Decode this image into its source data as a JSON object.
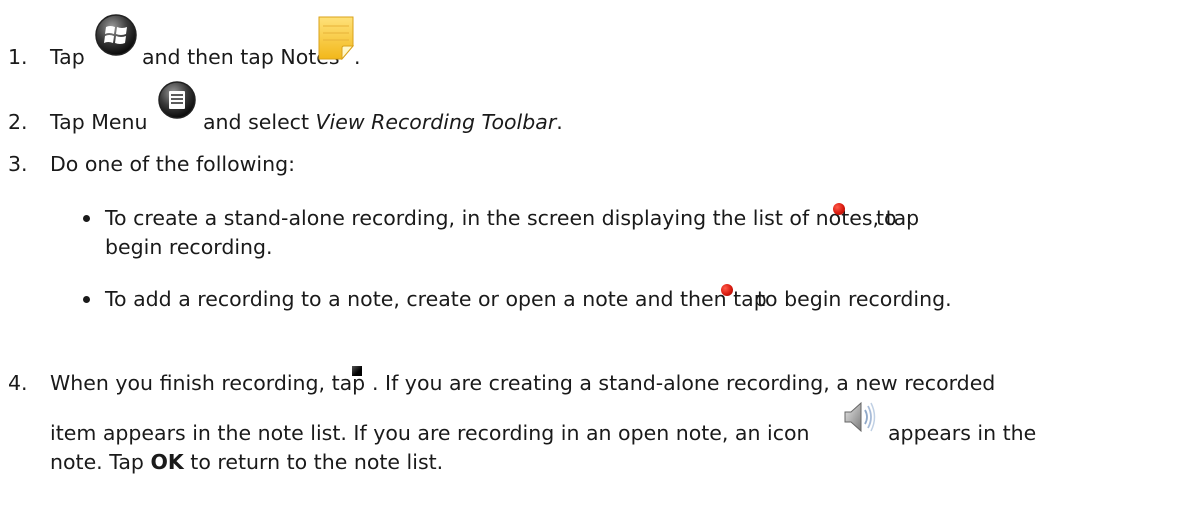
{
  "steps": [
    {
      "number": "1.",
      "parts": [
        "Tap",
        "and then tap Notes",
        "."
      ]
    },
    {
      "number": "2.",
      "parts": [
        "Tap Menu",
        "and select",
        "View Recording Toolbar",
        "."
      ]
    },
    {
      "number": "3.",
      "text": "Do one of the following:",
      "bullets": [
        {
          "line1_before": "To create a stand-alone recording, in the screen displaying the list of notes, tap",
          "line1_after": "to",
          "line2": "begin recording."
        },
        {
          "before": "To add a recording to a note, create or open a note and then tap",
          "after": "to begin recording."
        }
      ]
    },
    {
      "number": "4.",
      "line1_before": "When you finish recording, tap",
      "line1_after": ". If you are creating a stand-alone recording, a new recorded",
      "line2_before": "item appears in the note list. If you are recording in an open note, an icon",
      "line2_after": "appears in the",
      "line3_before": "note. Tap",
      "line3_bold": "OK",
      "line3_after": "to return to the note list."
    }
  ],
  "icons": {
    "start": "windows-start-icon",
    "notes": "notes-app-icon",
    "menu": "menu-icon",
    "record": "record-icon",
    "stop": "stop-icon",
    "speaker": "speaker-icon"
  },
  "colors": {
    "text": "#1a1a1a",
    "record_red": "#d81a0e",
    "notes_yellow": "#f7c623"
  }
}
